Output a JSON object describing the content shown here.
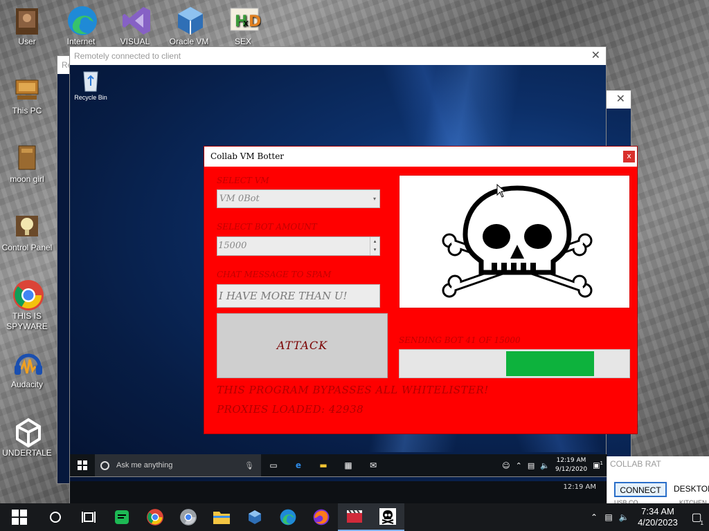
{
  "desktop_icons": [
    {
      "label": "User",
      "icon": "user-folder-icon"
    },
    {
      "label": "Internet",
      "icon": "edge-icon"
    },
    {
      "label": "VISUAL",
      "icon": "visual-studio-icon"
    },
    {
      "label": "Oracle VM",
      "icon": "virtualbox-icon"
    },
    {
      "label": "SEX",
      "icon": "hxd-icon"
    },
    {
      "label": "This PC",
      "icon": "computer-icon"
    },
    {
      "label": "moon girl",
      "icon": "archive-icon"
    },
    {
      "label": "Control Panel",
      "icon": "control-panel-icon"
    },
    {
      "label": "THIS IS SPYWARE",
      "icon": "chrome-icon"
    },
    {
      "label": "Audacity",
      "icon": "audacity-icon"
    },
    {
      "label": "UNDERTALE",
      "icon": "unity-icon"
    }
  ],
  "remote_window": {
    "title": "Remotely connected to client",
    "recycle_bin_label": "Recycle Bin",
    "behind_title_fragment": "Re",
    "behind_label_fragment": "Re"
  },
  "inner_taskbar": {
    "search_placeholder": "Ask me anything",
    "time": "12:19 AM",
    "date": "9/12/2020",
    "notification_count": "1",
    "lower_time": "12:19 AM"
  },
  "botter": {
    "title": "Collab VM Botter",
    "close_label": "x",
    "select_vm_label": "SELECT VM",
    "select_vm_value": "VM 0Bot",
    "bot_amount_label": "SELECT BOT AMOUNT",
    "bot_amount_value": "15000",
    "chat_label": "CHAT MESSAGE TO SPAM",
    "chat_value": "I HAVE MORE THAN U!",
    "attack_label": "ATTACK",
    "status": "SENDING BOT 41 OF 15000",
    "progress_fraction_start": 0.465,
    "progress_fraction_end": 0.845,
    "bypass_text": "THIS PROGRAM BYPASSES ALL WHITELISTER!",
    "proxies_text": "PROXIES LOADED: 42938"
  },
  "collab_rat": {
    "title": "COLLAB RAT",
    "connect_label": "CONNECT",
    "desktop_label": "DESKTOP",
    "kitchen_fragment": "KITCHEN",
    "usb_fragment": "USB CO"
  },
  "taskbar": {
    "time": "7:34 AM",
    "date": "4/20/2023",
    "notification_count": "1"
  },
  "colors": {
    "botter_bg": "#ff0000",
    "progress_fill": "#0db23d",
    "label_red": "#c20000"
  }
}
